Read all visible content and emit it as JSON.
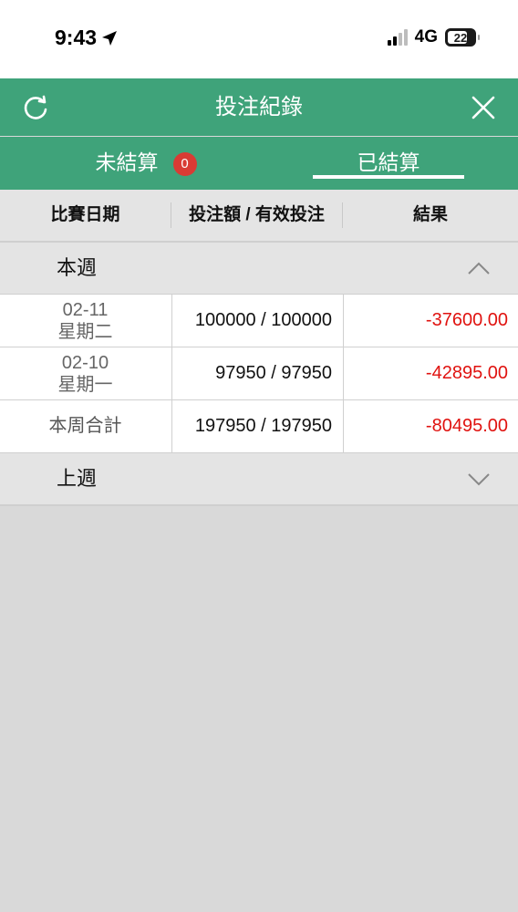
{
  "status": {
    "time": "9:43",
    "network": "4G",
    "battery": "22"
  },
  "header": {
    "title": "投注紀錄"
  },
  "tabs": {
    "unsettled_label": "未結算",
    "unsettled_count": "0",
    "settled_label": "已結算"
  },
  "columns": {
    "date": "比賽日期",
    "amount": "投注額 / 有效投注",
    "result": "結果"
  },
  "this_week": {
    "label": "本週",
    "rows": [
      {
        "date": "02-11",
        "weekday": "星期二",
        "amount": "100000 / 100000",
        "result": "-37600.00"
      },
      {
        "date": "02-10",
        "weekday": "星期一",
        "amount": "97950 / 97950",
        "result": "-42895.00"
      }
    ],
    "total": {
      "label": "本周合計",
      "amount": "197950 / 197950",
      "result": "-80495.00"
    }
  },
  "last_week": {
    "label": "上週"
  },
  "colors": {
    "header_green": "#3fa37a",
    "negative_red": "#e0120f",
    "badge_red": "#d93b34"
  }
}
